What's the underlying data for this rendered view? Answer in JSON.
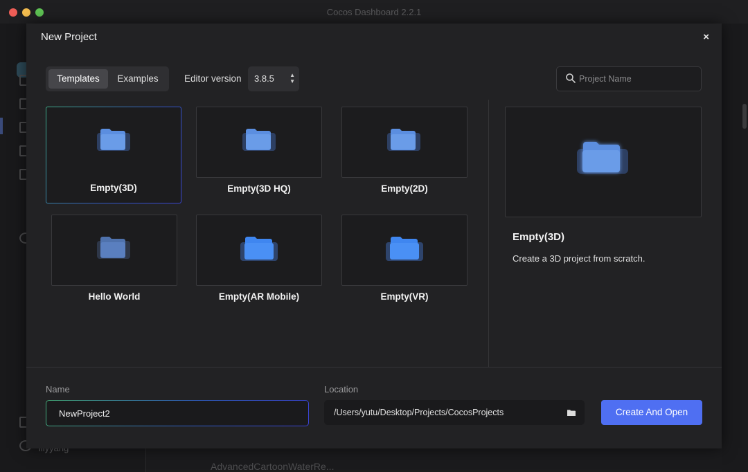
{
  "window": {
    "title": "Cocos Dashboard 2.2.1"
  },
  "background_app": {
    "user_name": "lilyyang",
    "project_item": "AdvancedCartoonWaterRe..."
  },
  "dialog": {
    "title": "New Project",
    "close_glyph": "×",
    "tabs": [
      {
        "label": "Templates",
        "active": true
      },
      {
        "label": "Examples",
        "active": false
      }
    ],
    "editor_version": {
      "label": "Editor version",
      "value": "3.8.5"
    },
    "search": {
      "placeholder": "Project Name",
      "value": ""
    },
    "templates": [
      {
        "label": "Empty(3D)",
        "selected": true,
        "icon": "folder-icon"
      },
      {
        "label": "Empty(3D HQ)",
        "selected": false,
        "icon": "folder-icon"
      },
      {
        "label": "Empty(2D)",
        "selected": false,
        "icon": "folder-icon"
      },
      {
        "label": "Hello World",
        "selected": false,
        "icon": "folder-icon"
      },
      {
        "label": "Empty(AR Mobile)",
        "selected": false,
        "icon": "folder-icon"
      },
      {
        "label": "Empty(VR)",
        "selected": false,
        "icon": "folder-icon"
      }
    ],
    "preview": {
      "title": "Empty(3D)",
      "description": "Create a 3D project from scratch."
    },
    "name_field": {
      "label": "Name",
      "value": "NewProject2"
    },
    "location_field": {
      "label": "Location",
      "value": "/Users/yutu/Desktop/Projects/CocosProjects"
    },
    "create_button": {
      "label": "Create And Open"
    }
  },
  "colors": {
    "accent": "#4f6ff2",
    "folder_light": "#5b8ee0",
    "folder_bright": "#3f86f0",
    "selection_gradient_start": "#3fae8a",
    "selection_gradient_end": "#3a47d6"
  }
}
